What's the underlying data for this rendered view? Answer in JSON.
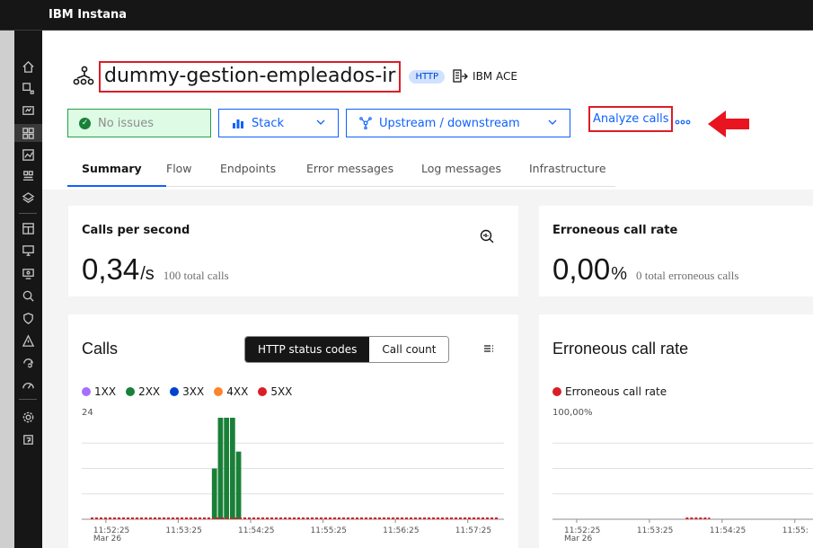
{
  "app": {
    "title": "IBM Instana"
  },
  "service": {
    "name": "dummy-gestion-empleados-ir",
    "protocol_tag": "HTTP",
    "technology": "IBM ACE"
  },
  "toolbar": {
    "status_label": "No issues",
    "stack_label": "Stack",
    "updown_label": "Upstream / downstream",
    "analyze_label": "Analyze calls"
  },
  "tabs": [
    "Summary",
    "Flow",
    "Endpoints",
    "Error messages",
    "Log messages",
    "Infrastructure"
  ],
  "active_tab": "Summary",
  "metrics": {
    "cps": {
      "title": "Calls per second",
      "value": "0,34",
      "unit": "/s",
      "sub": "100 total calls"
    },
    "err": {
      "title": "Erroneous call rate",
      "value": "0,00",
      "unit": "%",
      "sub": "0 total erroneous calls"
    }
  },
  "calls_chart": {
    "title": "Calls",
    "toggle": [
      "HTTP status codes",
      "Call count"
    ],
    "legend": [
      {
        "name": "1XX",
        "color": "#a56eff"
      },
      {
        "name": "2XX",
        "color": "#198038"
      },
      {
        "name": "3XX",
        "color": "#0043ce"
      },
      {
        "name": "4XX",
        "color": "#ff832b"
      },
      {
        "name": "5XX",
        "color": "#da1e28"
      }
    ],
    "ymax_label": "24",
    "date_label": "Mar 26",
    "x_ticks": [
      "11:52:25",
      "11:53:25",
      "11:54:25",
      "11:55:25",
      "11:56:25",
      "11:57:25"
    ]
  },
  "err_chart": {
    "title": "Erroneous call rate",
    "legend": [
      {
        "name": "Erroneous call rate",
        "color": "#da1e28"
      }
    ],
    "ymax_label": "100,00%",
    "date_label": "Mar 26",
    "x_ticks": [
      "11:52:25",
      "11:53:25",
      "11:54:25",
      "11:55:"
    ]
  },
  "chart_data": [
    {
      "type": "bar",
      "title": "Calls",
      "ylim": [
        0,
        24
      ],
      "x_ticks": [
        "11:52:25",
        "11:53:25",
        "11:54:25",
        "11:55:25",
        "11:56:25",
        "11:57:25"
      ],
      "series": [
        {
          "name": "2XX",
          "color": "#198038",
          "bars": [
            {
              "t": "11:53:55",
              "value": 12
            },
            {
              "t": "11:54:00",
              "value": 24
            },
            {
              "t": "11:54:05",
              "value": 24
            },
            {
              "t": "11:54:10",
              "value": 24
            },
            {
              "t": "11:54:15",
              "value": 16
            }
          ]
        },
        {
          "name": "5XX",
          "color": "#da1e28",
          "values": "0 across range"
        }
      ]
    },
    {
      "type": "line",
      "title": "Erroneous call rate",
      "ylim": [
        0,
        100
      ],
      "x_ticks": [
        "11:52:25",
        "11:53:25",
        "11:54:25",
        "11:55:"
      ],
      "series": [
        {
          "name": "Erroneous call rate",
          "color": "#da1e28",
          "values": "0 across range"
        }
      ]
    }
  ]
}
